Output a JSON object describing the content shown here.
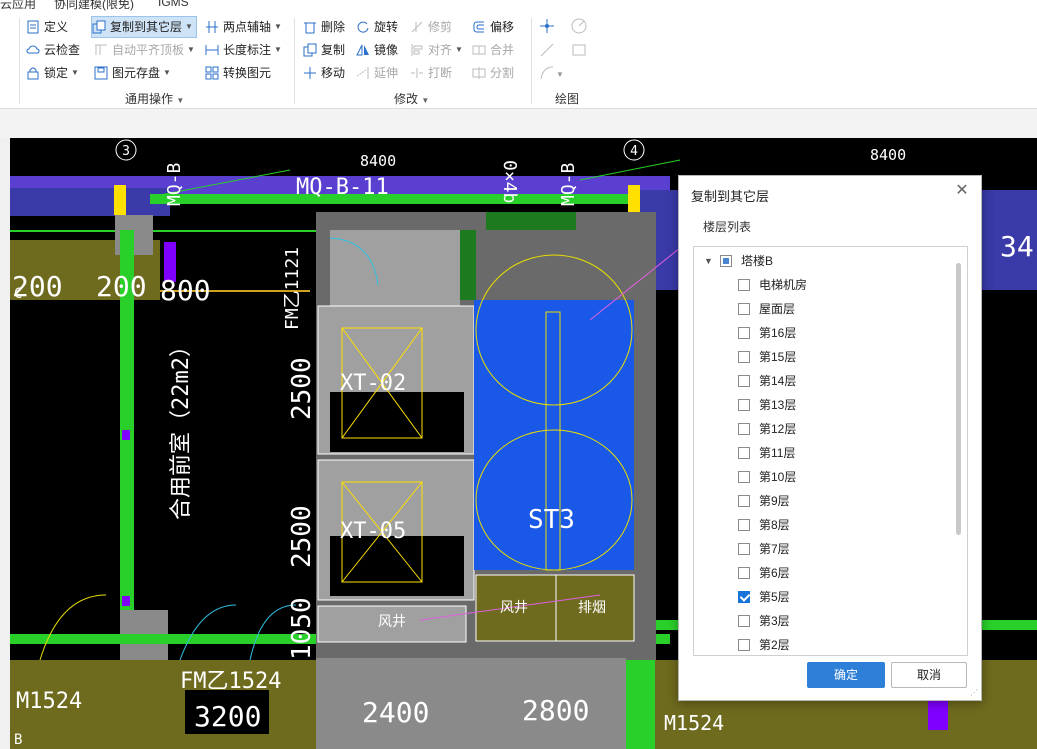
{
  "tabs": [
    "云应用",
    "协同建模(限免)",
    "IGMS"
  ],
  "ribbon": {
    "groups": [
      {
        "label": "通用操作"
      },
      {
        "label": "修改"
      },
      {
        "label": "绘图"
      }
    ],
    "general": {
      "define": "定义",
      "cloud_check": "云检查",
      "lock": "锁定",
      "copy_to_floor": "复制到其它层",
      "auto_flush_slab": "自动平齐顶板",
      "element_save": "图元存盘",
      "two_point_axis": "两点辅轴",
      "length_dim": "长度标注",
      "convert_element": "转换图元"
    },
    "modify": {
      "delete": "删除",
      "copy": "复制",
      "move": "移动",
      "rotate": "旋转",
      "mirror": "镜像",
      "extend": "延伸",
      "trim": "修剪",
      "align": "对齐",
      "break": "打断",
      "offset": "偏移",
      "merge": "合并",
      "split": "分割"
    }
  },
  "canvas": {
    "axis_labels": [
      "3",
      "4",
      "C",
      "B"
    ],
    "dimensions": [
      "8400",
      "8400",
      "200",
      "200",
      "800",
      "2500",
      "2500",
      "1050",
      "3200",
      "2400",
      "2800",
      "34"
    ],
    "room_labels": [
      "XT-02",
      "XT-05",
      "ST3",
      "风井",
      "风井",
      "排烟",
      "合用前室（22m2）"
    ],
    "tags": [
      "MQ-B-11",
      "MQ-B",
      "MQ-B",
      "FM乙1524",
      "FM乙1121",
      "M1524",
      "M1524",
      "0×4b"
    ]
  },
  "dialog": {
    "title": "复制到其它层",
    "floor_list_label": "楼层列表",
    "root": {
      "label": "塔楼B",
      "state": "partial"
    },
    "floors": [
      {
        "label": "电梯机房",
        "checked": false
      },
      {
        "label": "屋面层",
        "checked": false
      },
      {
        "label": "第16层",
        "checked": false
      },
      {
        "label": "第15层",
        "checked": false
      },
      {
        "label": "第14层",
        "checked": false
      },
      {
        "label": "第13层",
        "checked": false
      },
      {
        "label": "第12层",
        "checked": false
      },
      {
        "label": "第11层",
        "checked": false
      },
      {
        "label": "第10层",
        "checked": false
      },
      {
        "label": "第9层",
        "checked": false
      },
      {
        "label": "第8层",
        "checked": false
      },
      {
        "label": "第7层",
        "checked": false
      },
      {
        "label": "第6层",
        "checked": false
      },
      {
        "label": "第5层",
        "checked": true
      },
      {
        "label": "第3层",
        "checked": false
      },
      {
        "label": "第2层",
        "checked": false
      }
    ],
    "ok_label": "确定",
    "cancel_label": "取消"
  }
}
